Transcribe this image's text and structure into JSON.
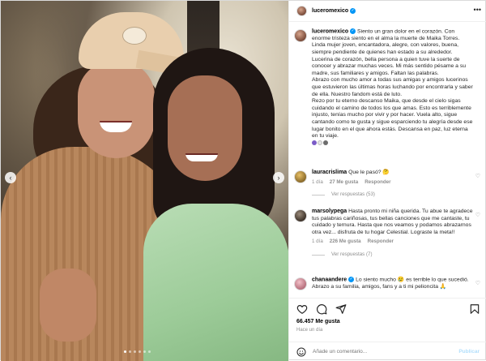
{
  "post": {
    "username": "luceromexico",
    "more_label": "•••",
    "caption": [
      "Siento un gran dolor en el corazón. Con enorme tristeza siento en el alma la muerte de Maika Torres. Linda mujer joven, encantadora, alegre, con valores, buena, siempre pendiente de quienes han estado a su alrededor.",
      "Lucerina de corazón, bella persona a quien tuve la suerte de conocer y abrazar muchas veces. Mi más sentido pésame a su madre, sus familiares y amigos. Faltan las palabras.",
      "Abrazo con mucho amor a todas sus amigas y amigos lucerinos que estuvieron las últimas horas luchando por encontrarla y saber de ella. Nuestro fandom está de luto.",
      "Rezo por tu eterno descanso Maika, que desde el cielo sigas cuidando el camino de todos los que amas. Esto es terriblemente injusto, tenías mucho por vivir y por hacer. Vuela alto, sigue cantando como te gusta y sigue esparciendo tu alegría desde ese lugar bonito en el que ahora estás. Descansa en paz, luz eterna en tu viaje."
    ],
    "likes": "66.457 Me gusta",
    "time_ago": "Hace un día"
  },
  "comments": [
    {
      "username": "lauracrislima",
      "text": "Que le pasó?",
      "meta": [
        "1 día",
        "27 Me gusta",
        "Responder"
      ],
      "replies": "Ver respuestas (53)"
    },
    {
      "username": "marsolypega",
      "text": "Hasta pronto mi niña querida. Tu abue te agradece tus palabras cariñosas, tus bellas canciones que me cantaste, tu cuidado y ternura. Hasta que nos veamos y podamos abrazarnos otra vez... disfruta de tu hogar Celestial. Lograste la meta!!",
      "meta": [
        "1 día",
        "226 Me gusta",
        "Responder"
      ],
      "replies": "Ver respuestas (7)"
    },
    {
      "username": "chanaandere",
      "text": "Lo siento mucho 😢 es terrible lo que sucedió. Abrazo a su familia, amigos, fans y a ti mi pelioncita 🙏",
      "meta": [],
      "replies": ""
    }
  ],
  "composer": {
    "placeholder": "Añade un comentario...",
    "publish_label": "Publicar"
  },
  "media": {
    "nav_prev": "‹",
    "nav_next": "›"
  },
  "colors": {
    "verified": "#0095f6",
    "meta": "#8e8e8e",
    "publish_disabled": "#b2dffc"
  }
}
